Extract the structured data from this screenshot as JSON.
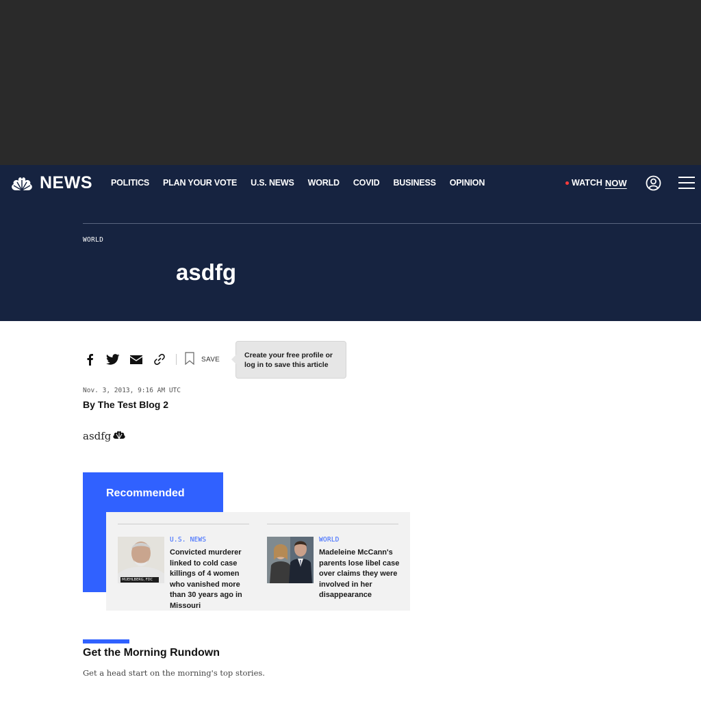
{
  "header": {
    "brand": "NEWS",
    "nav": [
      "POLITICS",
      "PLAN YOUR VOTE",
      "U.S. NEWS",
      "WORLD",
      "COVID",
      "BUSINESS",
      "OPINION"
    ],
    "watch_label": "WATCH",
    "now_label": "NOW"
  },
  "article": {
    "section": "WORLD",
    "title": "asdfg",
    "save_label": "SAVE",
    "save_tooltip": "Create your free profile or log in to save this article",
    "date": "Nov. 3, 2013, 9:16 AM UTC",
    "byline": "By The Test Blog 2",
    "body": "asdfg"
  },
  "recommended": {
    "title": "Recommended",
    "items": [
      {
        "section": "U.S. NEWS",
        "headline": "Convicted murderer linked to cold case killings of 4 women who vanished more than 30 years ago in Missouri",
        "thumb_caption": "MUEHLBERG, FDC"
      },
      {
        "section": "WORLD",
        "headline": "Madeleine McCann's parents lose libel case over claims they were involved in her disappearance"
      }
    ]
  },
  "newsletter": {
    "title": "Get the Morning Rundown",
    "subtitle": "Get a head start on the morning's top stories."
  },
  "icons": {
    "logo": "nbc-peacock-icon",
    "profile": "profile-icon",
    "menu": "menu-icon",
    "share": [
      "facebook-icon",
      "twitter-icon",
      "email-icon",
      "link-icon"
    ],
    "save": "bookmark-icon"
  },
  "colors": {
    "navy": "#162340",
    "accent_blue": "#3061ff",
    "ad_band": "#2a2a2a",
    "live_dot": "#ff3b3b",
    "panel_grey": "#f2f2f2"
  }
}
